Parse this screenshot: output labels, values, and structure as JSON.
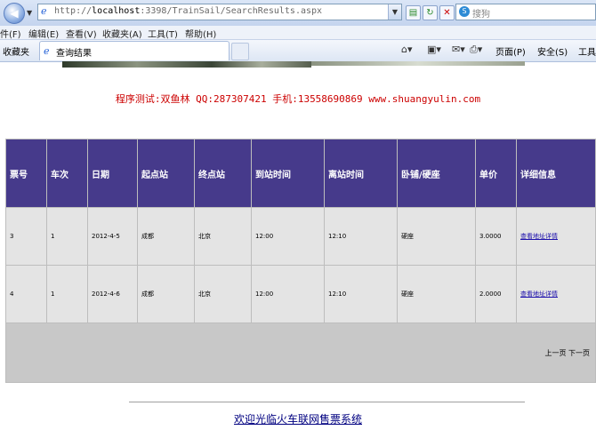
{
  "browser": {
    "address": {
      "prefix": "http://",
      "host": "localhost",
      "path": ":3398/TrainSail/SearchResults.aspx"
    },
    "search_placeholder": "搜狗",
    "menu": [
      "件(F)",
      "编辑(E)",
      "查看(V)",
      "收藏夹(A)",
      "工具(T)",
      "帮助(H)"
    ],
    "favorites_label": "收藏夹",
    "tab_title": "查询结果",
    "commands": {
      "page": "页面(P)",
      "safety": "安全(S)",
      "tools": "工具"
    }
  },
  "page": {
    "headline": "程序测试:双鱼林 QQ:287307421 手机:13558690869 www.shuangyulin.com",
    "table": {
      "headers": [
        "票号",
        "车次",
        "日期",
        "起点站",
        "终点站",
        "到站时间",
        "离站时间",
        "卧铺/硬座",
        "单价",
        "详细信息"
      ],
      "rows": [
        {
          "ticket": "3",
          "train": "1",
          "date": "2012-4-5",
          "from": "成都",
          "to": "北京",
          "arrive": "12:00",
          "depart": "12:10",
          "seat": "硬座",
          "price": "3.0000",
          "detail": "查看地址详情"
        },
        {
          "ticket": "4",
          "train": "1",
          "date": "2012-4-6",
          "from": "成都",
          "to": "北京",
          "arrive": "12:00",
          "depart": "12:10",
          "seat": "硬座",
          "price": "2.0000",
          "detail": "查看地址详情"
        }
      ],
      "pager": {
        "prev": "上一页",
        "next": "下一页"
      }
    },
    "footer_link": "欢迎光临火车联网售票系统"
  },
  "colors": {
    "header_bg": "#463a8b",
    "row_bg": "#e4e4e4",
    "pager_bg": "#c8c8c8",
    "headline": "#cc0000",
    "link": "#000080"
  }
}
